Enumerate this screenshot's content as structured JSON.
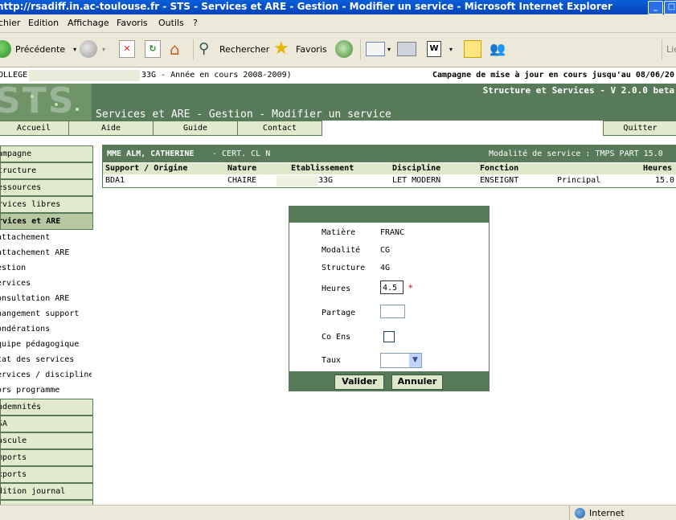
{
  "window": {
    "title": "http://rsadiff.in.ac-toulouse.fr - STS - Services et ARE - Gestion - Modifier un service - Microsoft Internet Explorer"
  },
  "menubar": [
    "chier",
    "Edition",
    "Affichage",
    "Favoris",
    "Outils",
    "?"
  ],
  "toolbar": {
    "back_label": "Précédente",
    "search_label": "Rechercher",
    "favorites_label": "Favoris",
    "links_label": "Lie"
  },
  "infobar": {
    "college_prefix": "OLLEGE",
    "year_text": "33G - Année en cours 2008-2009)",
    "campaign_text": "Campagne de mise à jour en cours jusqu'au 08/06/20"
  },
  "banner": {
    "logo": "STS",
    "version": "Structure et Services - V 2.0.0 beta",
    "page_title": "Services et ARE - Gestion - Modifier un service"
  },
  "nav": {
    "home": "Accueil",
    "help": "Aide",
    "guide": "Guide",
    "contact": "Contact",
    "quit": "Quitter"
  },
  "sidemenu": {
    "sections_top": [
      "ampagne",
      "tructure",
      "essources",
      "rvices libres",
      "rvices et ARE"
    ],
    "subitems": [
      "attachement",
      "attachement ARE",
      "estion",
      "ervices",
      "onsultation ARE",
      "hangement support",
      "ondérations",
      "quipe pédagogique",
      "tat des services",
      "ervices / discipline",
      "ors programme"
    ],
    "sections_bottom": [
      "ndemnités",
      "SA",
      "ascule",
      "mports",
      "xports",
      "dition journal"
    ]
  },
  "teacher": {
    "name": "MME ALM, CATHERINE",
    "grade": "- CERT. CL N",
    "modality": "Modalité  de service : TMPS PART  15.0",
    "columns": {
      "support": "Support / Origine",
      "nature": "Nature",
      "etab": "Etablissement",
      "discipline": "Discipline",
      "fonction": "Fonction",
      "heures": "Heures"
    },
    "row": {
      "support": "BDA1",
      "nature": "CHAIRE",
      "etab": "33G",
      "discipline": "LET MODERN",
      "fonction": "ENSEIGNT",
      "role": "Principal",
      "heures": "15.0"
    }
  },
  "form": {
    "matiere_label": "Matière",
    "matiere_value": "FRANC",
    "modalite_label": "Modalité",
    "modalite_value": "CG",
    "structure_label": "Structure",
    "structure_value": "4G",
    "heures_label": "Heures",
    "heures_value": "4.5",
    "required_mark": "*",
    "partage_label": "Partage",
    "partage_value": "",
    "coens_label": "Co Ens",
    "taux_label": "Taux",
    "taux_value": "",
    "validate_label": "Valider",
    "cancel_label": "Annuler"
  },
  "statusbar": {
    "zone": "Internet"
  },
  "colors": {
    "accent_green": "#577a58",
    "light_green": "#e1ebcc",
    "xp_blue": "#0842b8",
    "required_red": "#cc0000"
  }
}
